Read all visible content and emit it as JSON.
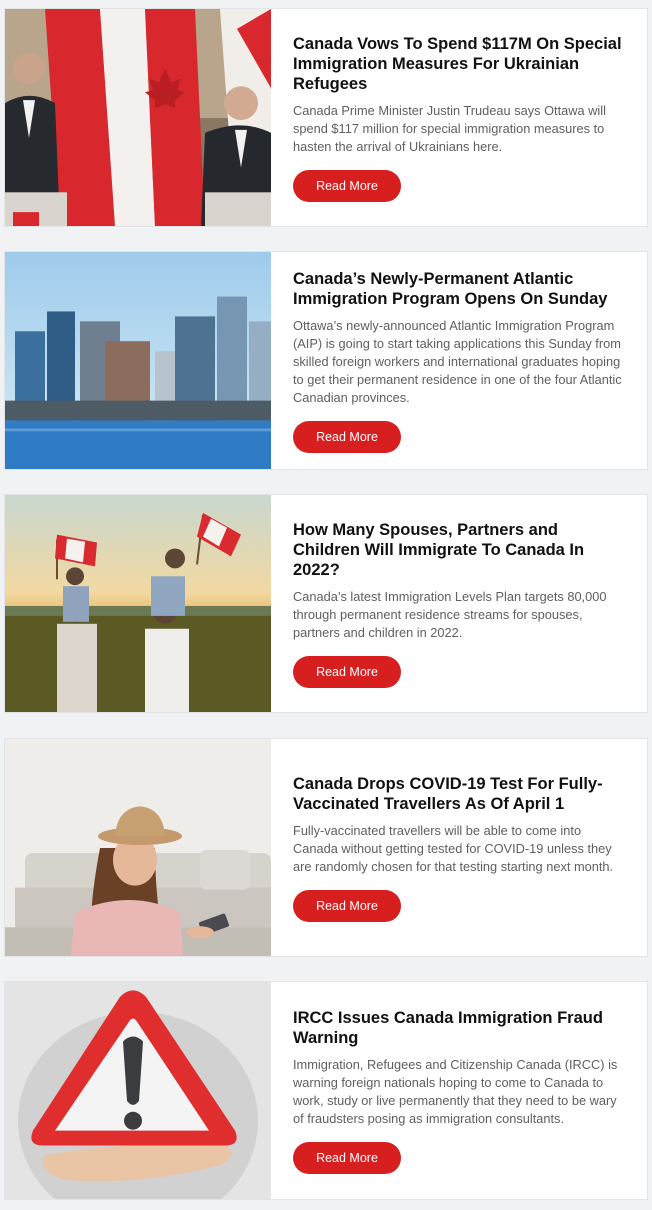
{
  "articles": [
    {
      "title": "Canada Vows To Spend $117M On Special Immigration Measures For Ukrainian Refugees",
      "excerpt": "Canada Prime Minister Justin Trudeau says Ottawa will spend $117 million for special immigration measures to hasten the arrival of Ukrainians here.",
      "button": "Read More",
      "image": "press-conference-photo"
    },
    {
      "title": "Canada’s Newly-Permanent Atlantic Immigration Program Opens On Sunday",
      "excerpt": "Ottawa’s newly-announced Atlantic Immigration Program (AIP) is going to start taking applications this Sunday from skilled foreign workers and international graduates hoping to get their permanent residence in one of the four Atlantic Canadian provinces.",
      "button": "Read More",
      "image": "city-skyline-photo"
    },
    {
      "title": "How Many Spouses, Partners and Children Will Immigrate To Canada In 2022?",
      "excerpt": "Canada’s latest Immigration Levels Plan targets 80,000 through permanent residence streams for spouses, partners and children in 2022.",
      "button": "Read More",
      "image": "family-flags-photo"
    },
    {
      "title": "Canada Drops COVID-19 Test For Fully-Vaccinated Travellers As Of April 1",
      "excerpt": "Fully-vaccinated travellers will be able to come into Canada without getting tested for COVID-19 unless they are randomly chosen for that testing starting next month.",
      "button": "Read More",
      "image": "traveller-phone-photo"
    },
    {
      "title": "IRCC Issues Canada Immigration Fraud Warning",
      "excerpt": "Immigration, Refugees and Citizenship Canada (IRCC) is warning foreign nationals hoping to come to Canada to work, study or live permanently that they need to be wary of fraudsters posing as immigration consultants.",
      "button": "Read More",
      "image": "warning-sign-photo"
    }
  ],
  "colors": {
    "accent": "#d71f20",
    "title": "#111111",
    "excerpt": "#5f5f5f",
    "background": "#f1f2f4"
  }
}
